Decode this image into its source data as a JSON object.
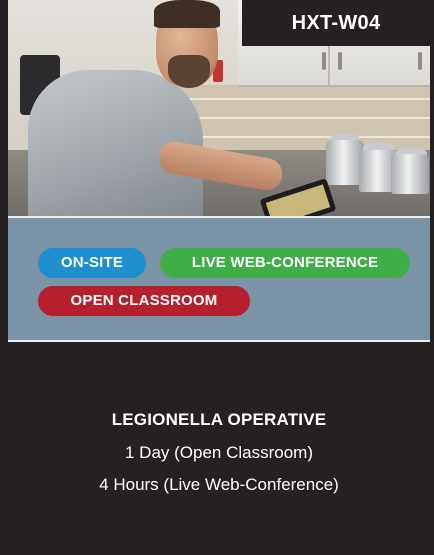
{
  "course": {
    "code": "HXT-W04",
    "title": "LEGIONELLA OPERATIVE",
    "durations": [
      "1 Day (Open Classroom)",
      "4 Hours (Live Web-Conference)"
    ]
  },
  "delivery_methods": [
    {
      "label": "ON-SITE",
      "color": "#1f8fcf"
    },
    {
      "label": "LIVE WEB-CONFERENCE",
      "color": "#3fae49"
    },
    {
      "label": "OPEN CLASSROOM",
      "color": "#b5202c"
    }
  ],
  "colors": {
    "panel_dark": "#252022",
    "band_blue_grey": "#7b93a6"
  }
}
